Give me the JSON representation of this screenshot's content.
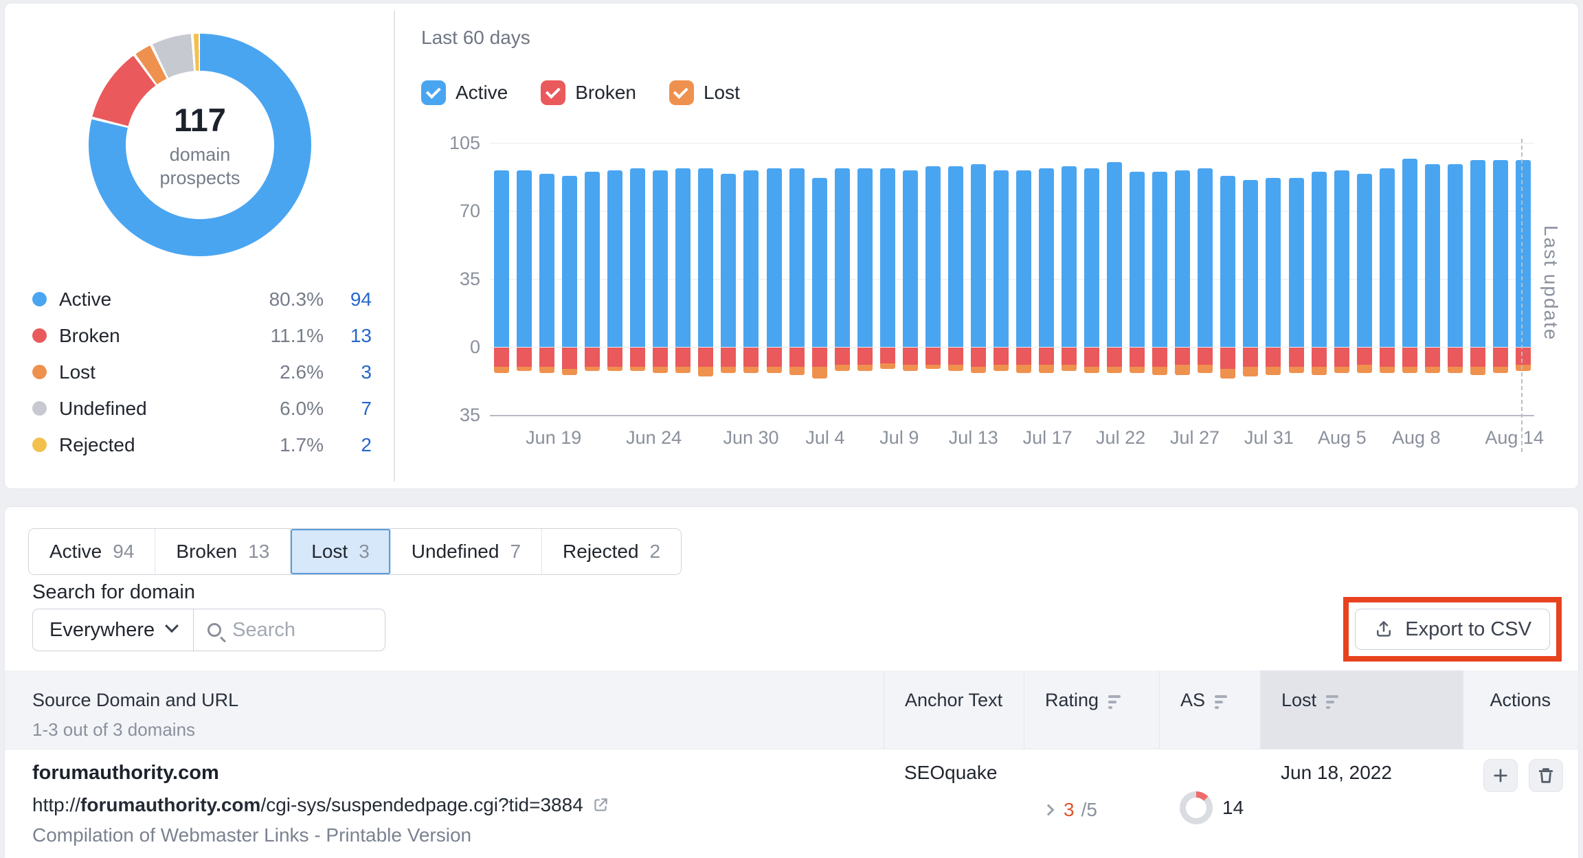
{
  "colors": {
    "active": "#4aa5f1",
    "broken": "#ea595c",
    "lost": "#ef914e",
    "undefined": "#c6c9d0",
    "rejected": "#f2c14d",
    "link": "#2766cc",
    "annotation": "#e7431f",
    "rating": "#e0552d"
  },
  "donut_panel": {
    "center_value": "117",
    "center_label": "domain prospects",
    "legend": [
      {
        "label": "Active",
        "percent": "80.3%",
        "count": "94",
        "color_key": "active"
      },
      {
        "label": "Broken",
        "percent": "11.1%",
        "count": "13",
        "color_key": "broken"
      },
      {
        "label": "Lost",
        "percent": "2.6%",
        "count": "3",
        "color_key": "lost"
      },
      {
        "label": "Undefined",
        "percent": "6.0%",
        "count": "7",
        "color_key": "undefined"
      },
      {
        "label": "Rejected",
        "percent": "1.7%",
        "count": "2",
        "color_key": "rejected"
      }
    ]
  },
  "trend_panel": {
    "title": "Last 60 days",
    "filters": [
      {
        "label": "Active",
        "color_key": "active",
        "checked": true
      },
      {
        "label": "Broken",
        "color_key": "broken",
        "checked": true
      },
      {
        "label": "Lost",
        "color_key": "lost",
        "checked": true
      }
    ]
  },
  "chart_data": {
    "type": "bar",
    "stacked": true,
    "title": "Last 60 days",
    "grid": "horizontal",
    "legend_position": "top",
    "ylim": [
      -35,
      105
    ],
    "y_ticks": [
      105,
      70,
      35,
      0,
      -35
    ],
    "y_tick_labels": [
      "105",
      "70",
      "35",
      "0",
      "35"
    ],
    "annotation_label": "Last update",
    "x_tick_labels": [
      {
        "label": "Jun 19",
        "pos_pct": 6.1
      },
      {
        "label": "Jun 24",
        "pos_pct": 15.7
      },
      {
        "label": "Jun 30",
        "pos_pct": 25.0
      },
      {
        "label": "Jul 4",
        "pos_pct": 32.1
      },
      {
        "label": "Jul 9",
        "pos_pct": 39.2
      },
      {
        "label": "Jul 13",
        "pos_pct": 46.3
      },
      {
        "label": "Jul 17",
        "pos_pct": 53.4
      },
      {
        "label": "Jul 22",
        "pos_pct": 60.4
      },
      {
        "label": "Jul 27",
        "pos_pct": 67.5
      },
      {
        "label": "Jul 31",
        "pos_pct": 74.6
      },
      {
        "label": "Aug 5",
        "pos_pct": 81.6
      },
      {
        "label": "Aug 8",
        "pos_pct": 88.7
      },
      {
        "label": "Aug 14",
        "pos_pct": 98.1
      }
    ],
    "series": [
      {
        "name": "Active",
        "color_key": "active",
        "direction": "up",
        "values": [
          91,
          91,
          89,
          88,
          90,
          91,
          92,
          91,
          92,
          92,
          89,
          91,
          92,
          92,
          87,
          92,
          92,
          92,
          91,
          93,
          93,
          94,
          91,
          91,
          92,
          93,
          92,
          95,
          90,
          90,
          91,
          92,
          88,
          86,
          87,
          87,
          90,
          91,
          89,
          92,
          97,
          94,
          94,
          96,
          96,
          96
        ]
      },
      {
        "name": "Broken",
        "color_key": "broken",
        "direction": "down",
        "values": [
          10,
          10,
          10,
          11,
          10,
          10,
          10,
          10,
          10,
          10,
          10,
          10,
          10,
          10,
          10,
          9,
          9,
          8,
          9,
          9,
          9,
          10,
          9,
          9,
          9,
          9,
          10,
          10,
          10,
          10,
          9,
          9,
          11,
          10,
          10,
          10,
          10,
          10,
          9,
          10,
          10,
          10,
          10,
          10,
          10,
          9
        ]
      },
      {
        "name": "Lost",
        "color_key": "lost",
        "direction": "down",
        "values": [
          3,
          2,
          3,
          3,
          2,
          2,
          2,
          3,
          3,
          5,
          3,
          3,
          3,
          4,
          6,
          3,
          3,
          3,
          3,
          2,
          3,
          3,
          3,
          4,
          4,
          3,
          3,
          3,
          3,
          4,
          5,
          4,
          5,
          5,
          4,
          3,
          4,
          3,
          4,
          3,
          3,
          3,
          3,
          4,
          3,
          3
        ]
      }
    ]
  },
  "tabs": [
    {
      "label": "Active",
      "count": "94",
      "selected": false
    },
    {
      "label": "Broken",
      "count": "13",
      "selected": false
    },
    {
      "label": "Lost",
      "count": "3",
      "selected": true
    },
    {
      "label": "Undefined",
      "count": "7",
      "selected": false
    },
    {
      "label": "Rejected",
      "count": "2",
      "selected": false
    }
  ],
  "search": {
    "label": "Search for domain",
    "scope": "Everywhere",
    "placeholder": "Search"
  },
  "export": {
    "label": "Export to CSV"
  },
  "table": {
    "columns": {
      "source": "Source Domain and URL",
      "anchor": "Anchor Text",
      "rating": "Rating",
      "as": "AS",
      "lost": "Lost",
      "actions": "Actions"
    },
    "subtitle": "1-3 out of 3 domains",
    "row": {
      "domain": "forumauthority.com",
      "url_prefix": "http://",
      "url_domain": "forumauthority.com",
      "url_path": "/cgi-sys/suspendedpage.cgi?tid=3884",
      "description": "Compilation of Webmaster Links - Printable Version",
      "anchor_text": "SEOquake",
      "rating_value": "3",
      "rating_max": "/5",
      "as_value": "14",
      "lost_date": "Jun 18, 2022"
    }
  }
}
